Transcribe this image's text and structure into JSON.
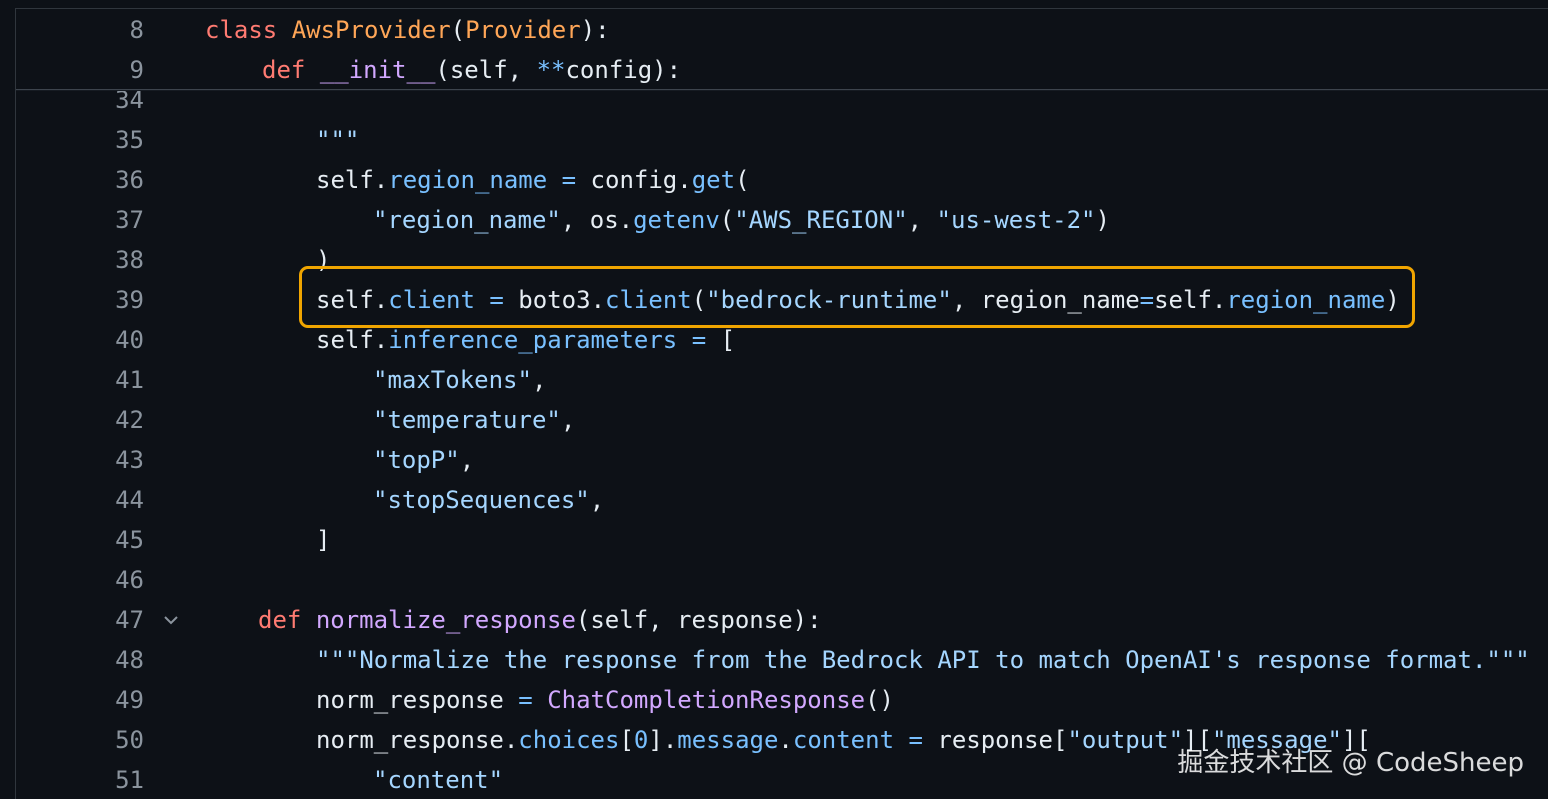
{
  "colors": {
    "background": "#0d1117",
    "line_number": "#8b949e",
    "keyword": "#ff7b72",
    "class_name": "#ffa657",
    "function_name": "#d2a8ff",
    "attribute": "#79c0ff",
    "string": "#a5d6ff",
    "highlight_border": "#f0a500"
  },
  "sticky_header": [
    {
      "number": "8",
      "tokens": [
        {
          "t": "class",
          "c": "kw"
        },
        {
          "t": " ",
          "c": "pl"
        },
        {
          "t": "AwsProvider",
          "c": "cls"
        },
        {
          "t": "(",
          "c": "pl"
        },
        {
          "t": "Provider",
          "c": "cls"
        },
        {
          "t": "):",
          "c": "pl"
        }
      ],
      "indent": 1
    },
    {
      "number": "9",
      "tokens": [
        {
          "t": "def",
          "c": "kw"
        },
        {
          "t": " ",
          "c": "pl"
        },
        {
          "t": "__init__",
          "c": "fn"
        },
        {
          "t": "(self, ",
          "c": "pl"
        },
        {
          "t": "**",
          "c": "op"
        },
        {
          "t": "config):",
          "c": "pl"
        }
      ],
      "indent": 2
    }
  ],
  "lines": [
    {
      "number": "34",
      "tokens": [],
      "indent": 0
    },
    {
      "number": "35",
      "tokens": [
        {
          "t": "\"\"\"",
          "c": "str"
        }
      ],
      "indent": 3
    },
    {
      "number": "36",
      "tokens": [
        {
          "t": "self",
          "c": "pl"
        },
        {
          "t": ".",
          "c": "pl"
        },
        {
          "t": "region_name",
          "c": "attr"
        },
        {
          "t": " ",
          "c": "pl"
        },
        {
          "t": "=",
          "c": "op"
        },
        {
          "t": " config",
          "c": "pl"
        },
        {
          "t": ".",
          "c": "pl"
        },
        {
          "t": "get",
          "c": "attr"
        },
        {
          "t": "(",
          "c": "pl"
        }
      ],
      "indent": 3
    },
    {
      "number": "37",
      "tokens": [
        {
          "t": "\"region_name\"",
          "c": "str"
        },
        {
          "t": ", os",
          "c": "pl"
        },
        {
          "t": ".",
          "c": "pl"
        },
        {
          "t": "getenv",
          "c": "attr"
        },
        {
          "t": "(",
          "c": "pl"
        },
        {
          "t": "\"AWS_REGION\"",
          "c": "str"
        },
        {
          "t": ", ",
          "c": "pl"
        },
        {
          "t": "\"us-west-2\"",
          "c": "str"
        },
        {
          "t": ")",
          "c": "pl"
        }
      ],
      "indent": 4
    },
    {
      "number": "38",
      "tokens": [
        {
          "t": ")",
          "c": "pl"
        }
      ],
      "indent": 3
    },
    {
      "number": "39",
      "tokens": [
        {
          "t": "self",
          "c": "pl"
        },
        {
          "t": ".",
          "c": "pl"
        },
        {
          "t": "client",
          "c": "attr"
        },
        {
          "t": " ",
          "c": "pl"
        },
        {
          "t": "=",
          "c": "op"
        },
        {
          "t": " boto3",
          "c": "pl"
        },
        {
          "t": ".",
          "c": "pl"
        },
        {
          "t": "client",
          "c": "attr"
        },
        {
          "t": "(",
          "c": "pl"
        },
        {
          "t": "\"bedrock-runtime\"",
          "c": "str"
        },
        {
          "t": ", region_name",
          "c": "pl"
        },
        {
          "t": "=",
          "c": "op"
        },
        {
          "t": "self",
          "c": "pl"
        },
        {
          "t": ".",
          "c": "pl"
        },
        {
          "t": "region_name",
          "c": "attr"
        },
        {
          "t": ")",
          "c": "pl"
        }
      ],
      "indent": 3
    },
    {
      "number": "40",
      "tokens": [
        {
          "t": "self",
          "c": "pl"
        },
        {
          "t": ".",
          "c": "pl"
        },
        {
          "t": "inference_parameters",
          "c": "attr"
        },
        {
          "t": " ",
          "c": "pl"
        },
        {
          "t": "=",
          "c": "op"
        },
        {
          "t": " [",
          "c": "pl"
        }
      ],
      "indent": 3
    },
    {
      "number": "41",
      "tokens": [
        {
          "t": "\"maxTokens\"",
          "c": "str"
        },
        {
          "t": ",",
          "c": "pl"
        }
      ],
      "indent": 4
    },
    {
      "number": "42",
      "tokens": [
        {
          "t": "\"temperature\"",
          "c": "str"
        },
        {
          "t": ",",
          "c": "pl"
        }
      ],
      "indent": 4
    },
    {
      "number": "43",
      "tokens": [
        {
          "t": "\"topP\"",
          "c": "str"
        },
        {
          "t": ",",
          "c": "pl"
        }
      ],
      "indent": 4
    },
    {
      "number": "44",
      "tokens": [
        {
          "t": "\"stopSequences\"",
          "c": "str"
        },
        {
          "t": ",",
          "c": "pl"
        }
      ],
      "indent": 4
    },
    {
      "number": "45",
      "tokens": [
        {
          "t": "]",
          "c": "pl"
        }
      ],
      "indent": 3
    },
    {
      "number": "46",
      "tokens": [],
      "indent": 0
    },
    {
      "number": "47",
      "fold": true,
      "tokens": [
        {
          "t": "def",
          "c": "kw"
        },
        {
          "t": " ",
          "c": "pl"
        },
        {
          "t": "normalize_response",
          "c": "fn"
        },
        {
          "t": "(self, response):",
          "c": "pl"
        }
      ],
      "indent": 2
    },
    {
      "number": "48",
      "tokens": [
        {
          "t": "\"\"\"Normalize the response from the Bedrock API to match OpenAI's response format.\"\"\"",
          "c": "str"
        }
      ],
      "indent": 3
    },
    {
      "number": "49",
      "tokens": [
        {
          "t": "norm_response",
          "c": "pl"
        },
        {
          "t": " ",
          "c": "pl"
        },
        {
          "t": "=",
          "c": "op"
        },
        {
          "t": " ",
          "c": "pl"
        },
        {
          "t": "ChatCompletionResponse",
          "c": "fn"
        },
        {
          "t": "()",
          "c": "pl"
        }
      ],
      "indent": 3
    },
    {
      "number": "50",
      "tokens": [
        {
          "t": "norm_response",
          "c": "pl"
        },
        {
          "t": ".",
          "c": "pl"
        },
        {
          "t": "choices",
          "c": "attr"
        },
        {
          "t": "[",
          "c": "pl"
        },
        {
          "t": "0",
          "c": "attr"
        },
        {
          "t": "]",
          "c": "pl"
        },
        {
          "t": ".",
          "c": "pl"
        },
        {
          "t": "message",
          "c": "attr"
        },
        {
          "t": ".",
          "c": "pl"
        },
        {
          "t": "content",
          "c": "attr"
        },
        {
          "t": " ",
          "c": "pl"
        },
        {
          "t": "=",
          "c": "op"
        },
        {
          "t": " response[",
          "c": "pl"
        },
        {
          "t": "\"output\"",
          "c": "str"
        },
        {
          "t": "][",
          "c": "pl"
        },
        {
          "t": "\"message\"",
          "c": "str"
        },
        {
          "t": "][",
          "c": "pl"
        }
      ],
      "indent": 3
    },
    {
      "number": "51",
      "tokens": [
        {
          "t": "\"content\"",
          "c": "str"
        }
      ],
      "indent": 4
    }
  ],
  "highlighted_line": "39",
  "watermark": "掘金技术社区 @ CodeSheep"
}
